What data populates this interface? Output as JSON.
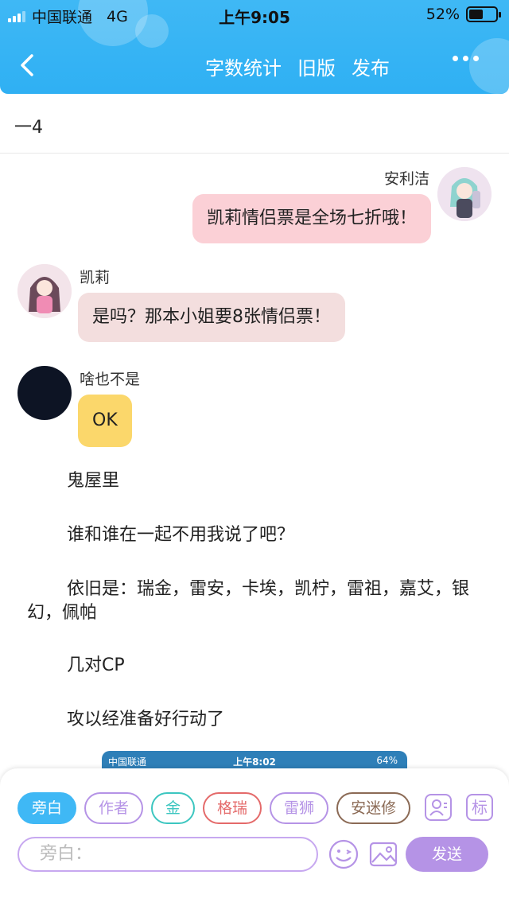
{
  "status_bar": {
    "carrier": "中国联通",
    "network": "4G",
    "time": "上午9:05",
    "battery": "52%",
    "battery_level": 0.52
  },
  "nav": {
    "actions": [
      "字数统计",
      "旧版",
      "发布"
    ]
  },
  "chapter_title": "一4",
  "messages": [
    {
      "speaker": "安利洁",
      "text": "凯莉情侣票是全场七折哦！",
      "side": "right",
      "bubble_color": "#fbd0d6"
    },
    {
      "speaker": "凯莉",
      "text": "是吗？那本小姐要8张情侣票！",
      "side": "left",
      "bubble_color": "#f3dede"
    },
    {
      "speaker": "啥也不是",
      "text": "OK",
      "side": "left",
      "bubble_color": "#fbd76b"
    }
  ],
  "narration": [
    "鬼屋里",
    "谁和谁在一起不用我说了吧？",
    "依旧是：瑞金，雷安，卡埃，凯柠，雷祖，嘉艾，银幻，佩帕",
    "几对CP",
    "攻以经准备好行动了"
  ],
  "embedded_screenshot": {
    "carrier": "中国联通",
    "time": "上午8:02",
    "battery": "64%"
  },
  "roles": [
    {
      "label": "旁白",
      "color": "#3fb8f5",
      "active": true
    },
    {
      "label": "作者",
      "color": "#b593e6",
      "active": false
    },
    {
      "label": "金",
      "color": "#3cc6c0",
      "active": false
    },
    {
      "label": "格瑞",
      "color": "#e46a6a",
      "active": false
    },
    {
      "label": "雷狮",
      "color": "#b593e6",
      "active": false
    },
    {
      "label": "安迷修",
      "color": "#8b6a55",
      "active": false
    }
  ],
  "tools": {
    "mark_label": "标"
  },
  "composer": {
    "placeholder": "旁白：",
    "send_label": "发送"
  }
}
